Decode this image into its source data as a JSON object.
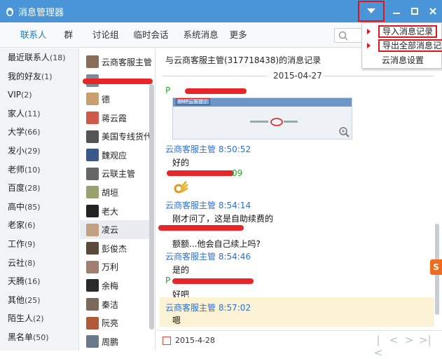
{
  "window": {
    "title": "消息管理器"
  },
  "tabs": [
    "联系人",
    "群",
    "讨论组",
    "临时会话",
    "系统消息",
    "更多"
  ],
  "search": {
    "placeholder": ""
  },
  "menu": {
    "items": [
      "导入消息记录",
      "导出全部消息记",
      "云消息设置"
    ]
  },
  "groups": [
    {
      "name": "最近联系人",
      "count": "(18)"
    },
    {
      "name": "我的好友",
      "count": "(1)"
    },
    {
      "name": "VIP",
      "count": "(2)"
    },
    {
      "name": "家人",
      "count": "(11)"
    },
    {
      "name": "大学",
      "count": "(66)"
    },
    {
      "name": "发小",
      "count": "(29)"
    },
    {
      "name": "老师",
      "count": "(10)"
    },
    {
      "name": "百度",
      "count": "(28)"
    },
    {
      "name": "高中",
      "count": "(85)"
    },
    {
      "name": "老家",
      "count": "(6)"
    },
    {
      "name": "工作",
      "count": "(9)"
    },
    {
      "name": "云社",
      "count": "(8)"
    },
    {
      "name": "天腾",
      "count": "(16)"
    },
    {
      "name": "其他",
      "count": "(25)"
    },
    {
      "name": "陌生人",
      "count": "(2)"
    },
    {
      "name": "黑名单",
      "count": "(50)"
    }
  ],
  "contacts": [
    "云商客服主管",
    "",
    "德",
    "蒋云霞",
    "美国专线货代",
    "魏观应",
    "云联主管",
    "胡垣",
    "老大",
    "凌云",
    "彭俊杰",
    "万利",
    "余梅",
    "秦洁",
    "阮亮",
    "周鹏"
  ],
  "chat": {
    "header": "与云商客服主管(317718438)的消息记录",
    "date": "2015-04-27",
    "screenshot_title": "BMP云客提示",
    "messages": [
      {
        "sender": "云商客服主管 8:50:52",
        "text": "好的"
      },
      {
        "sender": "09",
        "text": ""
      },
      {
        "sender": "云商客服主管 8:54:14",
        "text": "刚才问了，这是自助续费的"
      },
      {
        "sender": "",
        "text": "额额...他会自己续上吗?"
      },
      {
        "sender": "云商客服主管 8:54:46",
        "text": "是的"
      },
      {
        "sender": "",
        "text": "好吧"
      },
      {
        "sender": "云商客服主管 8:57:02",
        "text": "嗯"
      }
    ],
    "bottom_date": "2015-4-28"
  },
  "colors": {
    "titlebar": "#4a95d7",
    "accent_red": "#e0151b",
    "sender_blue": "#2d6fd6",
    "highlight": "#fbf3d4"
  }
}
